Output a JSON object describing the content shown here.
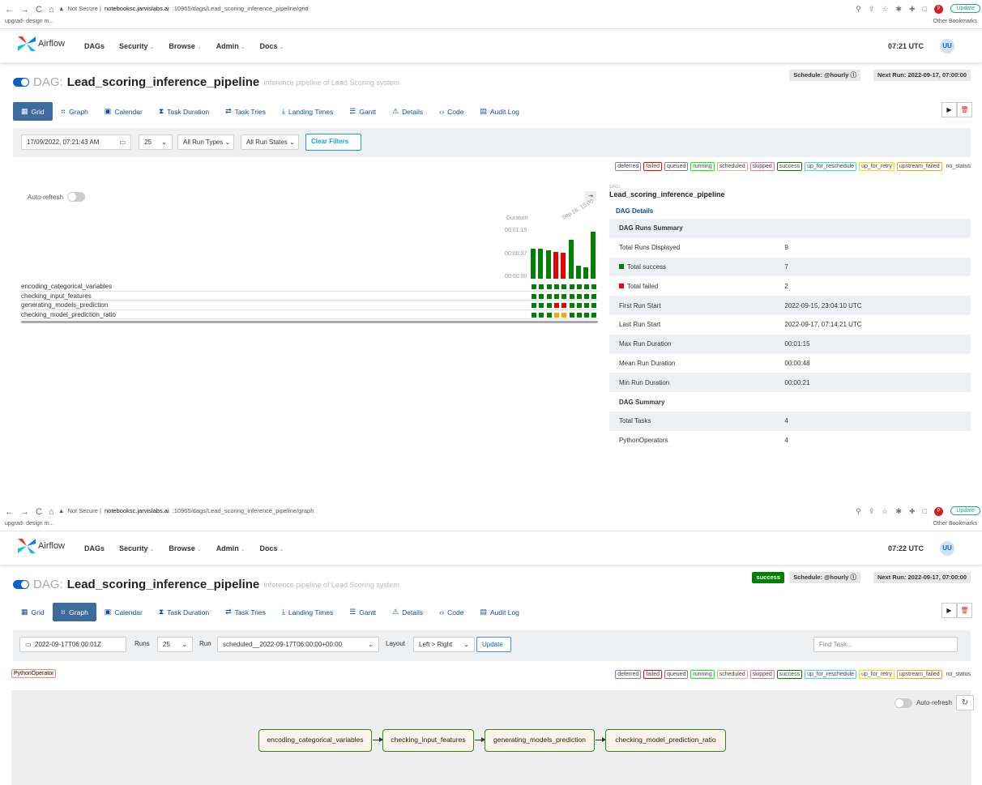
{
  "browser": {
    "top": {
      "url_prefix": "Not Secure | ",
      "url_host": "notebooksc.jarvislabs.ai",
      "url_path": ":10965/dags/Lead_scoring_inference_pipeline/grid"
    },
    "bottom": {
      "url_prefix": "Not Secure | ",
      "url_host": "notebooksc.jarvislabs.ai",
      "url_path": ":10965/dags/Lead_scoring_inference_pipeline/graph"
    },
    "bookmark": "upgrad- design m...",
    "other_bookmarks": "Other Bookmarks",
    "update_label": "Update",
    "profile_initial": "P"
  },
  "nav": {
    "brand": "Airflow",
    "items": [
      "DAGs",
      "Security",
      "Browse",
      "Admin",
      "Docs"
    ],
    "time_top": "07:21 UTC",
    "time_bottom": "07:22 UTC",
    "user_initials": "UU"
  },
  "dag": {
    "label": "DAG:",
    "name": "Lead_scoring_inference_pipeline",
    "description": "Inference pipeline of Lead Scoring system",
    "schedule": "Schedule: @hourly",
    "next_run": "Next Run: 2022-09-17, 07:00:00",
    "status_badge": "success"
  },
  "tabs": [
    {
      "label": "Grid",
      "icon": "grid-icon"
    },
    {
      "label": "Graph",
      "icon": "graph-icon"
    },
    {
      "label": "Calendar",
      "icon": "calendar-icon"
    },
    {
      "label": "Task Duration",
      "icon": "hourglass-icon"
    },
    {
      "label": "Task Tries",
      "icon": "retry-icon"
    },
    {
      "label": "Landing Times",
      "icon": "landing-icon"
    },
    {
      "label": "Gantt",
      "icon": "gantt-icon"
    },
    {
      "label": "Details",
      "icon": "warning-icon"
    },
    {
      "label": "Code",
      "icon": "code-icon"
    },
    {
      "label": "Audit Log",
      "icon": "log-icon"
    }
  ],
  "grid_filters": {
    "date": "17/09/2022, 07:21:43 AM",
    "count": "25",
    "run_types": "All Run Types",
    "run_states": "All Run States",
    "clear": "Clear Filters"
  },
  "legend": [
    {
      "label": "deferred",
      "color": "#9370db"
    },
    {
      "label": "failed",
      "color": "#ff0000"
    },
    {
      "label": "queued",
      "color": "#808080"
    },
    {
      "label": "running",
      "color": "#00ff00"
    },
    {
      "label": "scheduled",
      "color": "#d2b48c"
    },
    {
      "label": "skipped",
      "color": "#ff69b4"
    },
    {
      "label": "success",
      "color": "#008000"
    },
    {
      "label": "up_for_reschedule",
      "color": "#40e0d0"
    },
    {
      "label": "up_for_retry",
      "color": "#ffd700"
    },
    {
      "label": "upstream_failed",
      "color": "#ffa500"
    },
    {
      "label": "no_status",
      "color": ""
    }
  ],
  "grid": {
    "auto_refresh": "Auto-refresh",
    "expand": "⇥",
    "duration_label": "Duration",
    "duration_ticks": [
      "00:01:15",
      "00:00:37",
      "00:00:00"
    ],
    "date_label": "Sep 16, 15:00",
    "run_durations_s": [
      48,
      48,
      45,
      43,
      42,
      62,
      21,
      18,
      75
    ],
    "run_status": [
      "success",
      "success",
      "success",
      "failed",
      "failed",
      "success",
      "success",
      "success",
      "success"
    ],
    "tasks": [
      {
        "name": "encoding_categorical_variables",
        "states": [
          "success",
          "success",
          "success",
          "success",
          "success",
          "success",
          "success",
          "success",
          "success"
        ]
      },
      {
        "name": "checking_input_features",
        "states": [
          "success",
          "success",
          "success",
          "success",
          "success",
          "success",
          "success",
          "success",
          "success"
        ]
      },
      {
        "name": "generating_models_prediction",
        "states": [
          "success",
          "success",
          "success",
          "failed",
          "failed",
          "success",
          "success",
          "success",
          "success"
        ]
      },
      {
        "name": "checking_model_prediction_ratio",
        "states": [
          "success",
          "success",
          "success",
          "upstream_failed",
          "upstream_failed",
          "success",
          "success",
          "success",
          "success"
        ]
      }
    ]
  },
  "details": {
    "header": "DAG",
    "name": "Lead_scoring_inference_pipeline",
    "link": "DAG Details",
    "runs_summary_title": "DAG Runs Summary",
    "rows": [
      {
        "label": "Total Runs Displayed",
        "value": "9"
      },
      {
        "label": "Total success",
        "value": "7",
        "dot": "#008000"
      },
      {
        "label": "Total failed",
        "value": "2",
        "dot": "#ff0000"
      },
      {
        "label": "First Run Start",
        "value": "2022-09-15, 23:04:10 UTC"
      },
      {
        "label": "Last Run Start",
        "value": "2022-09-17, 07:14:21 UTC"
      },
      {
        "label": "Max Run Duration",
        "value": "00:01:15"
      },
      {
        "label": "Mean Run Duration",
        "value": "00:00:48"
      },
      {
        "label": "Min Run Duration",
        "value": "00:00:21"
      }
    ],
    "dag_summary_title": "DAG Summary",
    "summary_rows": [
      {
        "label": "Total Tasks",
        "value": "4"
      },
      {
        "label": "PythonOperators",
        "value": "4"
      }
    ]
  },
  "graph_filters": {
    "date": "2022-09-17T06:00:01Z",
    "runs_label": "Runs",
    "runs": "25",
    "run_label": "Run",
    "run": "scheduled__2022-09-17T06:00:00+00:00",
    "layout_label": "Layout",
    "layout": "Left > Right",
    "update": "Update",
    "find_placeholder": "Find Task..."
  },
  "graph": {
    "operator": "PythonOperator",
    "auto_refresh": "Auto-refresh",
    "nodes": [
      "encoding_categorical_variables",
      "checking_input_features",
      "generating_models_prediction",
      "checking_model_prediction_ratio"
    ]
  },
  "colors": {
    "success": "#008000",
    "failed": "#e60000",
    "upstream_failed": "#ffa500",
    "accent": "#0b63c9"
  }
}
